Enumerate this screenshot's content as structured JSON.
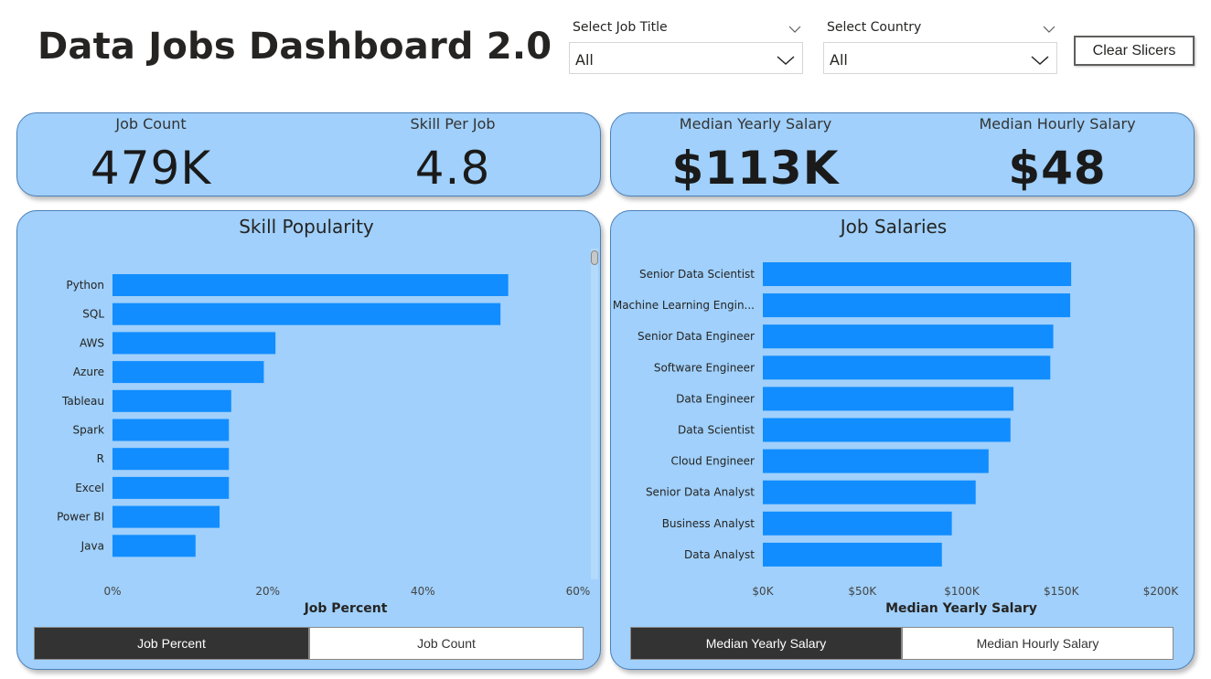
{
  "header": {
    "title": "Data Jobs Dashboard 2.0"
  },
  "slicers": {
    "job_title": {
      "label": "Select Job Title",
      "value": "All"
    },
    "country": {
      "label": "Select Country",
      "value": "All"
    }
  },
  "clear_button": {
    "label": "Clear Slicers"
  },
  "kpi_left": {
    "job_count": {
      "label": "Job Count",
      "value": "479K"
    },
    "skill_per_job": {
      "label": "Skill Per Job",
      "value": "4.8"
    }
  },
  "kpi_right": {
    "median_yearly": {
      "label": "Median Yearly Salary",
      "value": "$113K"
    },
    "median_hourly": {
      "label": "Median Hourly Salary",
      "value": "$48"
    }
  },
  "skill_chart": {
    "title": "Skill Popularity",
    "toggle_active": "Job Percent",
    "toggle_inactive": "Job Count"
  },
  "salary_chart": {
    "title": "Job Salaries",
    "toggle_active": "Median Yearly Salary",
    "toggle_inactive": "Median Hourly Salary"
  },
  "colors": {
    "card_bg": "#a0d0fb",
    "bar": "#118dff",
    "toggle_active": "#333333"
  },
  "icons": {
    "dropdown": "chevron-down-icon"
  },
  "chart_data": [
    {
      "type": "bar",
      "orientation": "horizontal",
      "title": "Skill Popularity",
      "xlabel": "Job Percent",
      "ylabel": "",
      "categories": [
        "Python",
        "SQL",
        "AWS",
        "Azure",
        "Tableau",
        "Spark",
        "R",
        "Excel",
        "Power BI",
        "Java"
      ],
      "values": [
        51,
        50,
        21,
        19.5,
        15.3,
        15,
        15,
        15,
        13.8,
        10.7
      ],
      "xlim": [
        0,
        60
      ],
      "xticks": [
        "0%",
        "20%",
        "40%",
        "60%"
      ],
      "color": "#118dff"
    },
    {
      "type": "bar",
      "orientation": "horizontal",
      "title": "Job Salaries",
      "xlabel": "Median Yearly Salary",
      "ylabel": "",
      "categories": [
        "Senior Data Scientist",
        "Machine Learning Engin...",
        "Senior Data Engineer",
        "Software Engineer",
        "Data Engineer",
        "Data Scientist",
        "Cloud Engineer",
        "Senior Data Analyst",
        "Business Analyst",
        "Data Analyst"
      ],
      "values": [
        155000,
        154500,
        146000,
        144500,
        126000,
        124500,
        113500,
        107000,
        95000,
        90000
      ],
      "xlim": [
        0,
        200000
      ],
      "xticks": [
        "$0K",
        "$50K",
        "$100K",
        "$150K",
        "$200K"
      ],
      "color": "#118dff"
    }
  ]
}
